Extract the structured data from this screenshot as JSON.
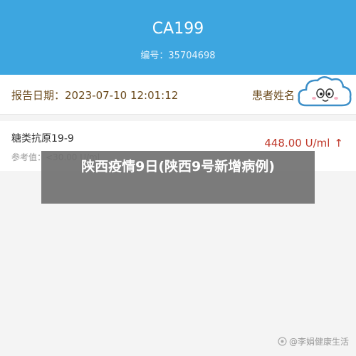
{
  "header": {
    "code": "CA199",
    "serial": "编号：35704698"
  },
  "report": {
    "date": "报告日期：2023-07-10 12:01:12",
    "patient_label": "患者姓名"
  },
  "result": {
    "test_name": "糖类抗原19-9",
    "reference": "参考值：<30.00 U/ml",
    "value": "448.00 U/ml",
    "arrow": "↑"
  },
  "overlay": {
    "headline": "陕西疫情9日(陕西9号新增病例)"
  },
  "watermark": {
    "text": "@李娟健康生活"
  },
  "colors": {
    "header_bg": "#3da6e0",
    "value_red": "#c0392b"
  },
  "icons": [
    "cloud-sticker-icon",
    "up-arrow-icon",
    "watermark-logo-icon"
  ]
}
